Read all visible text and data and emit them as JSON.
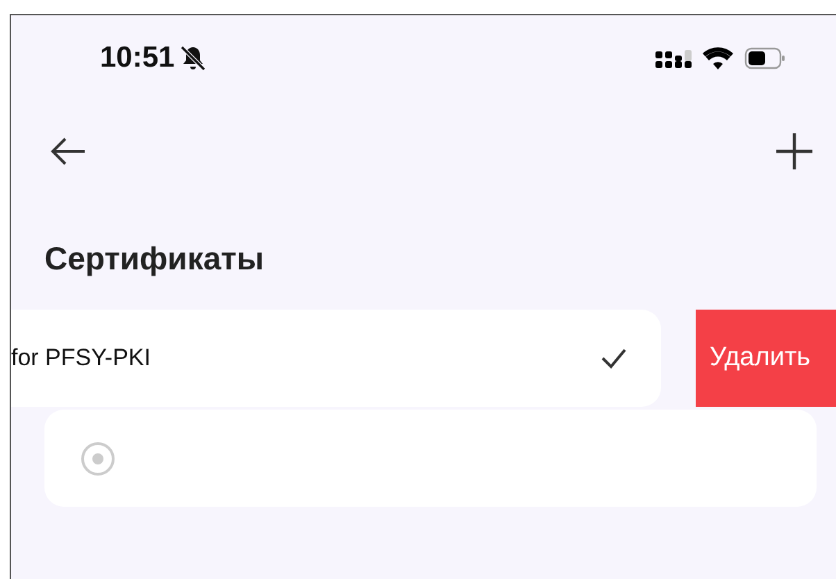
{
  "status_bar": {
    "time": "10:51",
    "silent": true
  },
  "title": "Сертификаты",
  "certificates": [
    {
      "kind": "swiped",
      "name": "for PFSY-PKI",
      "checked": true,
      "action": "Удалить"
    },
    {
      "kind": "radio"
    }
  ]
}
